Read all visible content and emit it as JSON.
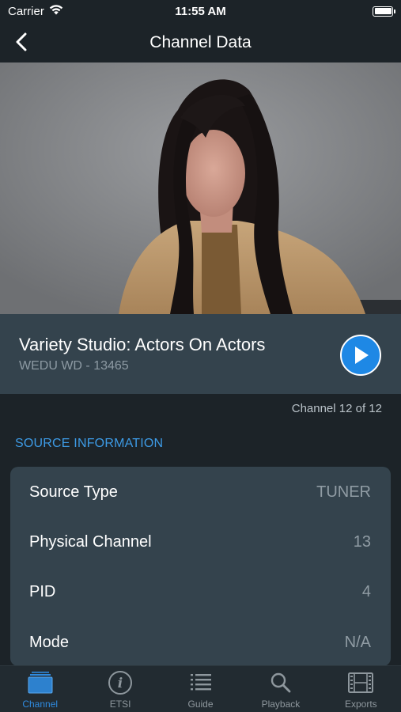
{
  "status_bar": {
    "carrier": "Carrier",
    "time": "11:55 AM"
  },
  "nav": {
    "title": "Channel Data"
  },
  "video": {
    "description_icon": "video-frame"
  },
  "program": {
    "title": "Variety Studio: Actors On Actors",
    "subtitle": "WEDU WD - 13465"
  },
  "channel_count": "Channel 12 of 12",
  "source_info": {
    "header": "SOURCE INFORMATION",
    "rows": [
      {
        "label": "Source Type",
        "value": "TUNER"
      },
      {
        "label": "Physical Channel",
        "value": "13"
      },
      {
        "label": "PID",
        "value": "4"
      },
      {
        "label": "Mode",
        "value": "N/A"
      }
    ]
  },
  "tabs": [
    {
      "label": "Channel",
      "icon": "channel-icon",
      "active": true
    },
    {
      "label": "ETSI",
      "icon": "info-icon",
      "active": false
    },
    {
      "label": "Guide",
      "icon": "list-icon",
      "active": false
    },
    {
      "label": "Playback",
      "icon": "search-icon",
      "active": false
    },
    {
      "label": "Exports",
      "icon": "film-icon",
      "active": false
    }
  ],
  "colors": {
    "background": "#1c2328",
    "card": "#34434d",
    "accent": "#2f8be0",
    "play": "#1e88e5"
  }
}
